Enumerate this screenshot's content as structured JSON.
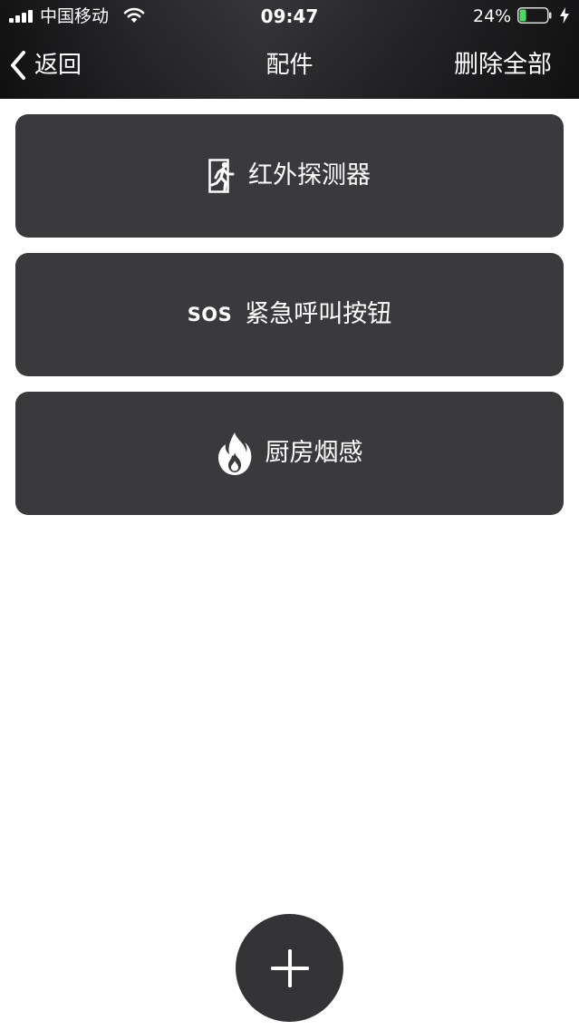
{
  "status_bar": {
    "carrier": "中国移动",
    "time": "09:47",
    "battery_percent": "24%",
    "battery_level": 0.24,
    "battery_color": "#4cd964"
  },
  "nav": {
    "back_label": "返回",
    "title": "配件",
    "delete_all_label": "删除全部"
  },
  "accessories": [
    {
      "icon": "exit-running-man-icon",
      "label": "红外探测器"
    },
    {
      "icon": "sos-icon",
      "icon_text": "SOS",
      "label": "紧急呼叫按钮"
    },
    {
      "icon": "fire-icon",
      "label": "厨房烟感"
    }
  ],
  "add_button": {
    "icon": "plus-icon"
  },
  "colors": {
    "card_background": "#3a393c",
    "page_background": "#ffffff",
    "add_button_background": "#343336"
  }
}
